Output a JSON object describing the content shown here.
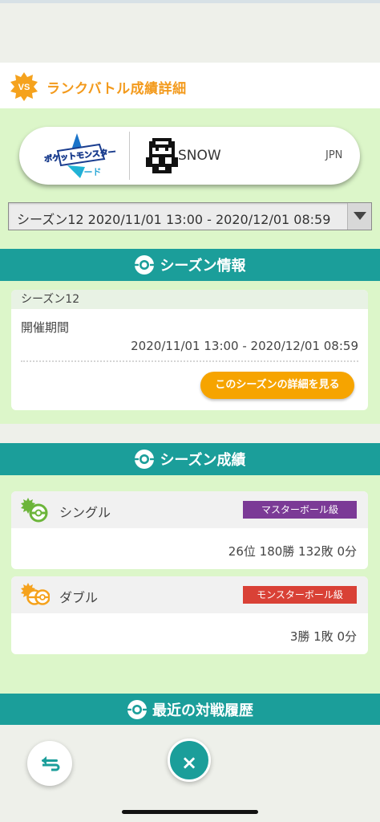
{
  "header": {
    "title": "ランクバトル成績詳細",
    "badge_text": "VS"
  },
  "trainer": {
    "game_logo": "ポケットモンスター ソード",
    "game_logo_line1": "ポケットモンスター",
    "game_logo_line2": "ソード",
    "name": "SNOW",
    "region": "JPN"
  },
  "season_select": {
    "selected": "シーズン12 2020/11/01 13:00 - 2020/12/01 08:59"
  },
  "season_info": {
    "section_title": "シーズン情報",
    "card_title": "シーズン12",
    "period_label": "開催期間",
    "period_value": "2020/11/01 13:00 - 2020/12/01 08:59",
    "detail_button": "このシーズンの詳細を見る"
  },
  "season_results": {
    "section_title": "シーズン成績",
    "single": {
      "label": "シングル",
      "rank": "マスターボール級",
      "rank_color": "#7b3a96",
      "stats": "26位 180勝 132敗 0分"
    },
    "double": {
      "label": "ダブル",
      "rank": "モンスターボール級",
      "rank_color": "#d94136",
      "stats": "3勝 1敗 0分"
    }
  },
  "recent": {
    "section_title": "最近の対戦履歴"
  },
  "nav": {
    "back_icon": "back-arrow-icon",
    "close_label": "×"
  },
  "colors": {
    "accent": "#1b9e9a",
    "title_orange": "#f39a1c",
    "button_orange": "#f6a400",
    "panel_green": "#dcf6c9"
  }
}
